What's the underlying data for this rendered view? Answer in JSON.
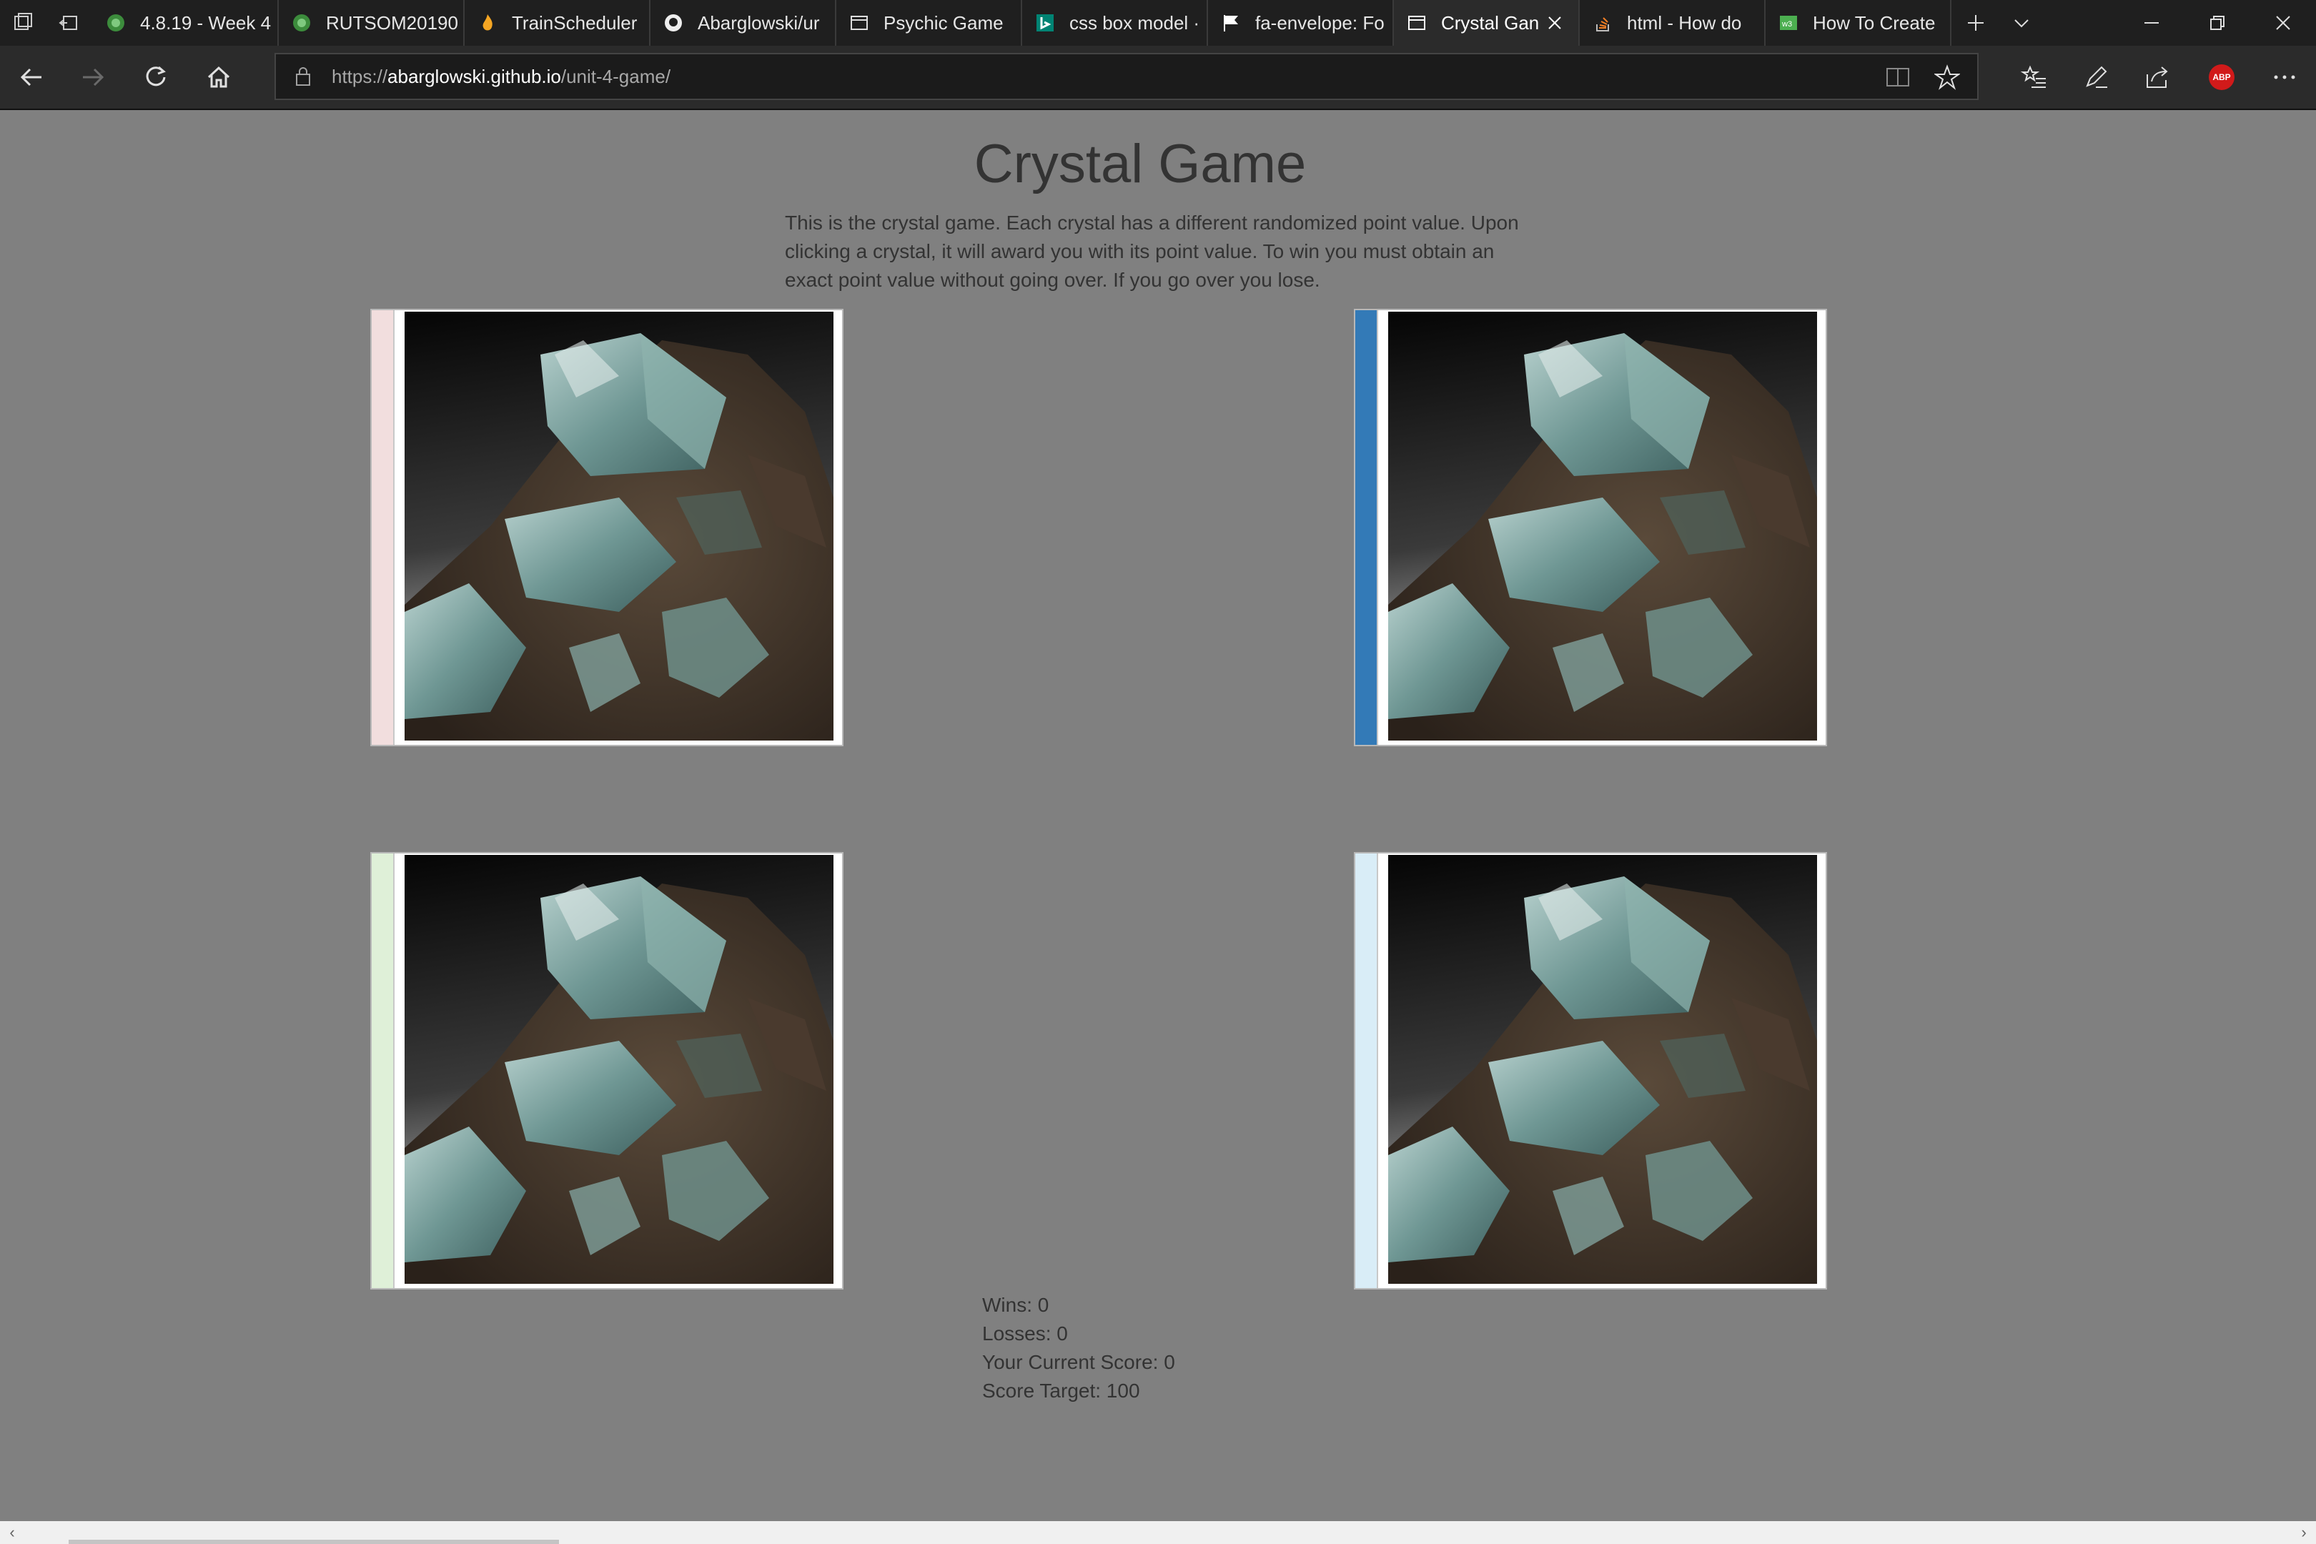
{
  "browser": {
    "tabs": [
      {
        "title": "4.8.19 - Week 4",
        "icon": "green-circle-icon"
      },
      {
        "title": "RUTSOM20190",
        "icon": "green-circle-icon"
      },
      {
        "title": "TrainScheduler",
        "icon": "flame-icon"
      },
      {
        "title": "Abarglowski/ur",
        "icon": "github-icon"
      },
      {
        "title": "Psychic Game",
        "icon": "page-icon"
      },
      {
        "title": "css box model ·",
        "icon": "bing-icon"
      },
      {
        "title": "fa-envelope: Fo",
        "icon": "flag-icon"
      },
      {
        "title": "Crystal Gan",
        "icon": "page-icon",
        "active": true
      },
      {
        "title": "html - How do",
        "icon": "stackoverflow-icon"
      },
      {
        "title": "How To Create",
        "icon": "w3-icon"
      }
    ],
    "address": {
      "prefix": "https://",
      "domain": "abarglowski.github.io",
      "path": "/unit-4-game/"
    },
    "extension_badge": "ABP"
  },
  "page": {
    "title": "Crystal Game",
    "intro": "This is the crystal game. Each crystal has a different randomized point value. Upon clicking a crystal, it will award you with its point value. To win you must obtain an exact point value without going over. If you go over you lose.",
    "crystals": [
      {
        "accent": "#f2dede"
      },
      {
        "accent": "#337ab7"
      },
      {
        "accent": "#dff0d8"
      },
      {
        "accent": "#d9edf7"
      }
    ],
    "stats": {
      "wins_label": "Wins: ",
      "wins": "0",
      "losses_label": "Losses: ",
      "losses": "0",
      "score_label": "Your Current Score: ",
      "score": "0",
      "target_label": "Score Target: ",
      "target": "100"
    }
  }
}
